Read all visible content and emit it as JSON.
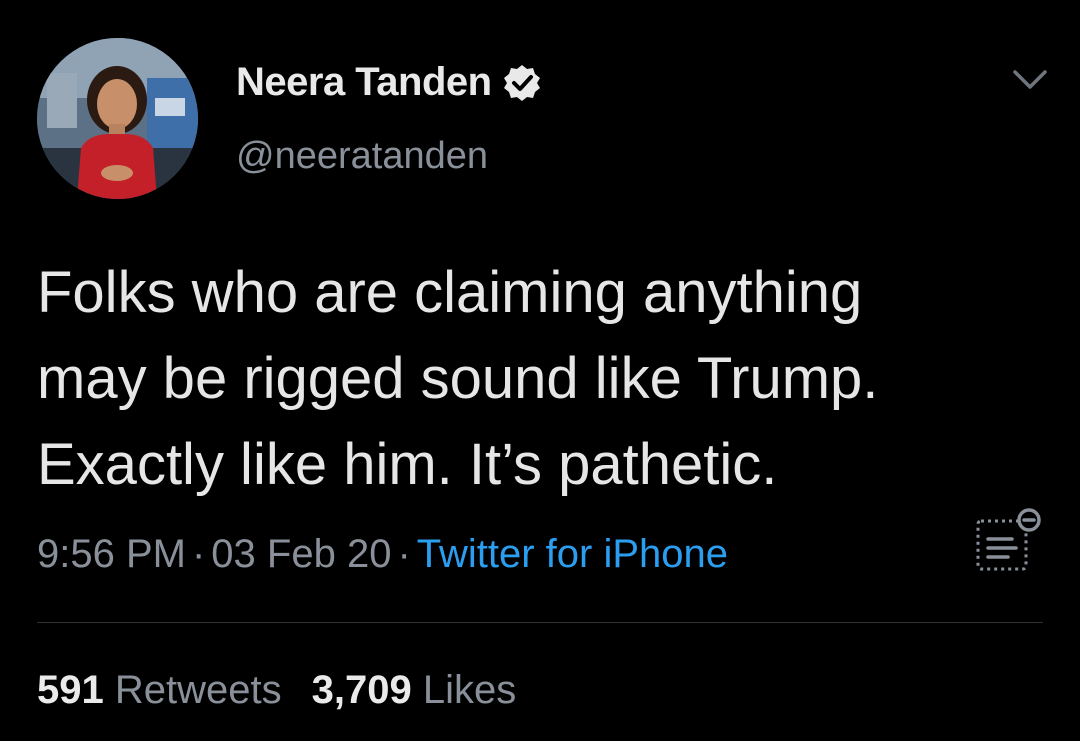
{
  "author": {
    "name": "Neera Tanden",
    "handle": "@neeratanden",
    "verified": true,
    "avatar_icon": "profile-photo"
  },
  "tweet": {
    "text": "Folks who are claiming anything\nmay be rigged sound like Trump.\nExactly like him. It’s pathetic.",
    "time": "9:56 PM",
    "date": "03 Feb 20",
    "separator": "·",
    "source": "Twitter for iPhone"
  },
  "stats": {
    "retweets_count": "591",
    "retweets_label": "Retweets",
    "likes_count": "3,709",
    "likes_label": "Likes"
  },
  "icons": {
    "menu": "chevron-down-icon",
    "analytics": "tweet-analytics-icon",
    "verified": "verified-badge-icon"
  },
  "colors": {
    "background": "#000000",
    "link": "#2b9ef0",
    "verified_badge": "#e9e9e9",
    "secondary_text": "#8a9099"
  }
}
